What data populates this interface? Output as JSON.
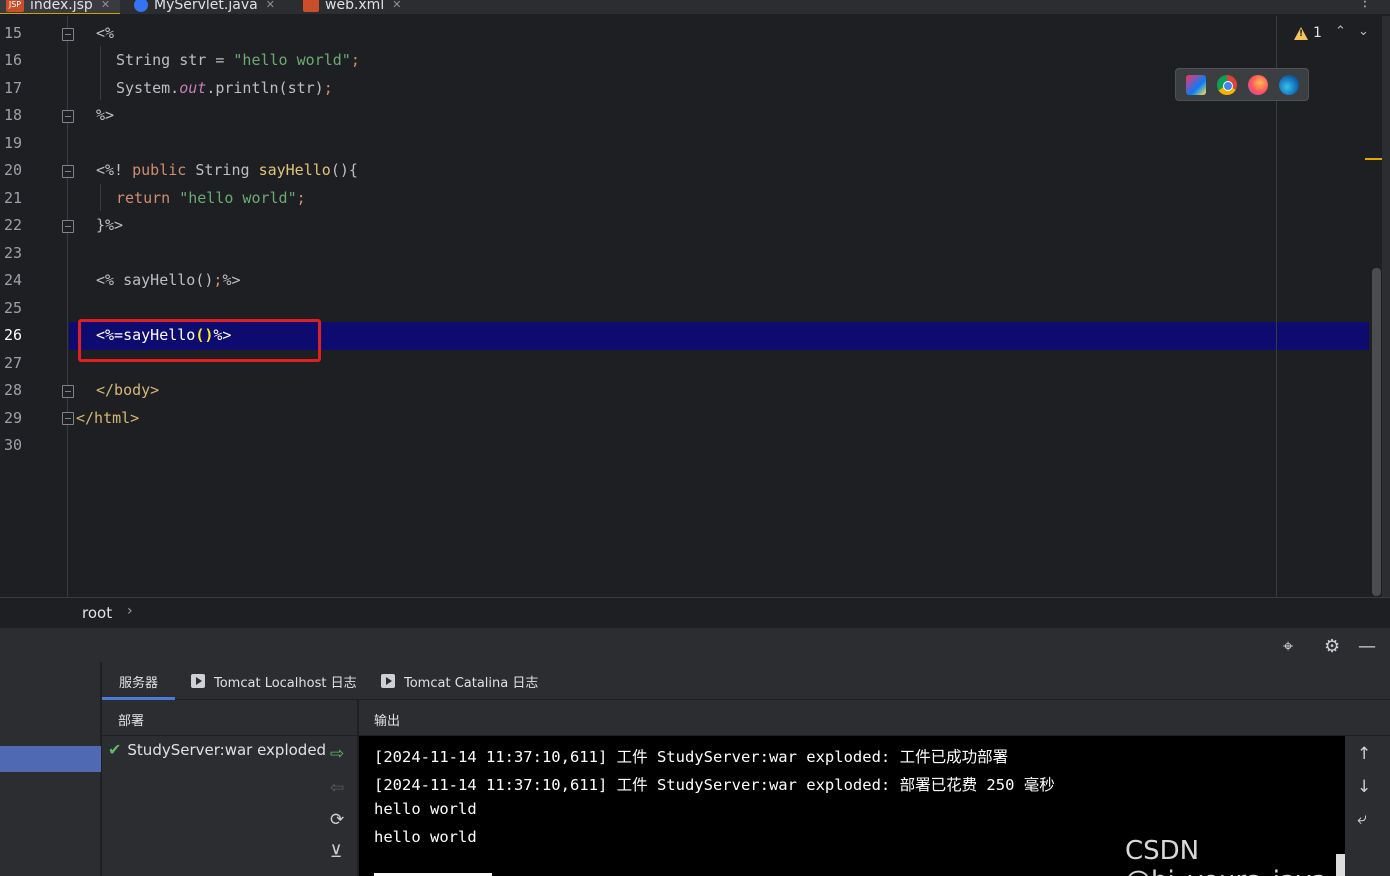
{
  "tabs": [
    {
      "label": "index.jsp",
      "icon": "jsp-file-icon",
      "badge": "JSP",
      "active": true
    },
    {
      "label": "MyServlet.java",
      "icon": "java-class-icon",
      "active": false
    },
    {
      "label": "web.xml",
      "icon": "xml-file-icon",
      "active": false
    }
  ],
  "editor": {
    "line_numbers": [
      "15",
      "16",
      "17",
      "18",
      "19",
      "20",
      "21",
      "22",
      "23",
      "24",
      "25",
      "26",
      "27",
      "28",
      "29",
      "30"
    ],
    "current_line": "26",
    "warnings_count": "1",
    "lines": {
      "l15": {
        "a": "<%"
      },
      "l16": {
        "a": "String str = ",
        "b": "\"hello world\"",
        "c": ";"
      },
      "l17": {
        "a": "System.",
        "b": "out",
        "c": ".println(str)",
        "d": ";"
      },
      "l18": {
        "a": "%>"
      },
      "l20": {
        "a": "<%! ",
        "b": "public",
        "c": " String ",
        "d": "sayHello",
        "e": "(){"
      },
      "l21": {
        "a": "return",
        "b": " \"hello world\"",
        "c": ";"
      },
      "l22": {
        "a": "}%>"
      },
      "l24": {
        "a": "<% sayHello()",
        "b": ";",
        "c": "%>"
      },
      "l26": {
        "a": "<%=sayHello",
        "b": "()",
        "c": "%>"
      },
      "l28": {
        "a": "</body>"
      },
      "l29": {
        "a": "</html>"
      }
    }
  },
  "breadcrumb": {
    "item": "root",
    "sep": "›"
  },
  "services": {
    "tabs": [
      {
        "label": "服务器",
        "active": true
      },
      {
        "label": "Tomcat Localhost 日志",
        "active": false
      },
      {
        "label": "Tomcat Catalina 日志",
        "active": false
      }
    ],
    "deploy_header": "部署",
    "deploy_item": "StudyServer:war exploded",
    "output_header": "输出",
    "console_lines": [
      "[2024-11-14 11:37:10,611] 工件 StudyServer:war exploded: 工件已成功部署",
      "[2024-11-14 11:37:10,611] 工件 StudyServer:war exploded: 部署已花费 250 毫秒",
      "hello world",
      "hello world"
    ]
  },
  "watermark": "CSDN @hi_yours_java"
}
